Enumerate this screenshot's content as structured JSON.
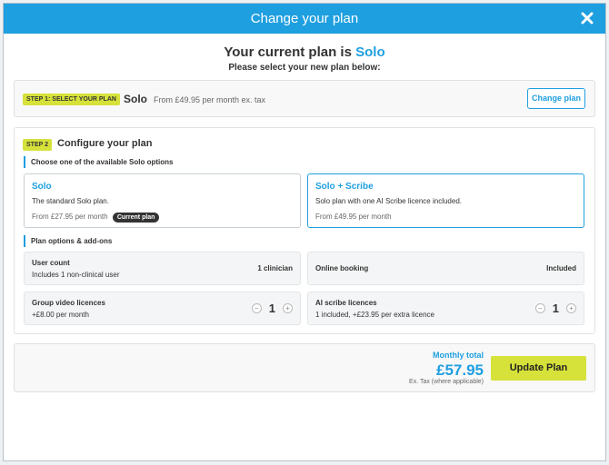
{
  "modal": {
    "title": "Change your plan"
  },
  "intro": {
    "heading_prefix": "Your current plan is",
    "current_plan": "Solo",
    "subheading": "Please select your new plan below:"
  },
  "step1": {
    "badge": "STEP 1: SELECT YOUR PLAN",
    "plan_name": "Solo",
    "plan_price": "From £49.95 per month ex. tax",
    "change_button": "Change plan"
  },
  "step2": {
    "badge": "STEP 2",
    "title": "Configure your plan",
    "options_label": "Choose one of the available Solo options",
    "options": [
      {
        "title": "Solo",
        "description": "The standard Solo plan.",
        "price": "From £27.95 per month",
        "tag": "Current plan",
        "selected": false
      },
      {
        "title": "Solo + Scribe",
        "description": "Solo plan with one AI Scribe licence included.",
        "price": "From £49.95 per month",
        "tag": "",
        "selected": true
      }
    ],
    "addons_label": "Plan options & add-ons",
    "addons": {
      "user_count": {
        "title": "User count",
        "subtitle": "Includes 1 non-clinical user",
        "value": "1 clinician"
      },
      "online_booking": {
        "title": "Online booking",
        "value": "Included"
      },
      "group_video": {
        "title": "Group video licences",
        "subtitle": "+£8.00 per month",
        "quantity": "1"
      },
      "ai_scribe": {
        "title": "AI scribe licences",
        "subtitle": "1 included, +£23.95 per extra licence",
        "quantity": "1"
      }
    }
  },
  "footer": {
    "total_label": "Monthly total",
    "total_amount": "£57.95",
    "tax_note": "Ex. Tax (where applicable)",
    "update_button": "Update Plan"
  },
  "colors": {
    "accent": "#1e9fe0",
    "highlight": "#d6e23a"
  },
  "icons": {
    "close": "close-icon",
    "minus": "minus-icon",
    "plus": "plus-icon"
  }
}
